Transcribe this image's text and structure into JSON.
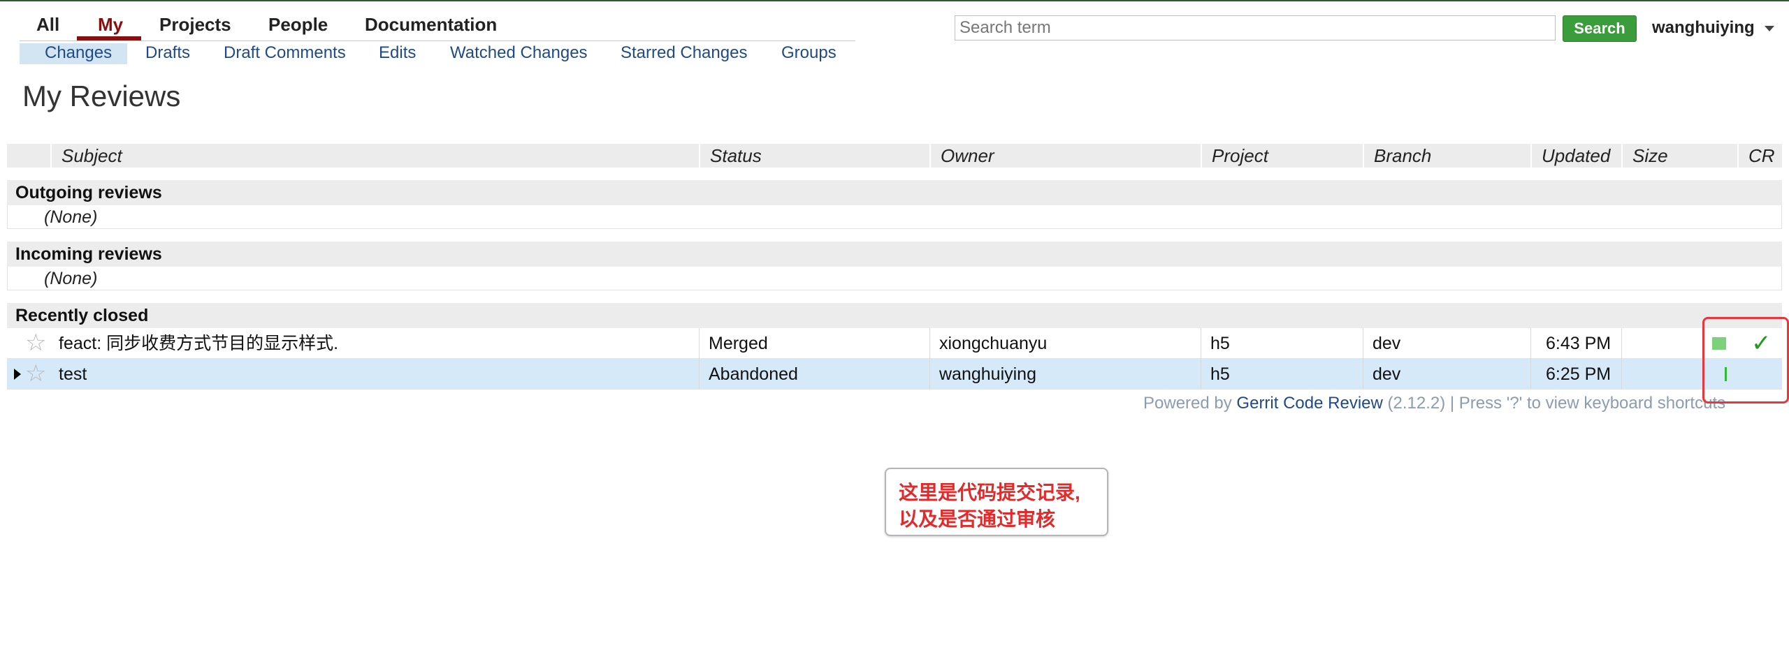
{
  "top_menu": {
    "items": [
      "All",
      "My",
      "Projects",
      "People",
      "Documentation"
    ],
    "active": "My"
  },
  "sub_menu": {
    "items": [
      "Changes",
      "Drafts",
      "Draft Comments",
      "Edits",
      "Watched Changes",
      "Starred Changes",
      "Groups"
    ],
    "selected": "Changes"
  },
  "search": {
    "placeholder": "Search term",
    "button_label": "Search"
  },
  "user": {
    "name": "wanghuiying"
  },
  "page": {
    "title": "My Reviews"
  },
  "table": {
    "columns": [
      "Subject",
      "Status",
      "Owner",
      "Project",
      "Branch",
      "Updated",
      "Size",
      "CR"
    ],
    "sections": [
      {
        "title": "Outgoing reviews",
        "empty_text": "(None)"
      },
      {
        "title": "Incoming reviews",
        "empty_text": "(None)"
      },
      {
        "title": "Recently closed"
      }
    ],
    "rows": [
      {
        "subject": "feact: 同步收费方式节目的显示样式.",
        "status": "Merged",
        "owner": "xiongchuanyu",
        "project": "h5",
        "branch": "dev",
        "updated": "6:43 PM",
        "cr": "✓"
      },
      {
        "subject": "test",
        "status": "Abandoned",
        "owner": "wanghuiying",
        "project": "h5",
        "branch": "dev",
        "updated": "6:25 PM",
        "cr": ""
      }
    ]
  },
  "footer": {
    "prefix": "Powered by",
    "link": "Gerrit Code Review",
    "suffix": "(2.12.2) | Press '?' to view keyboard shortcuts"
  },
  "annotation": {
    "line1": "这里是代码提交记录,",
    "line2": "以及是否通过审核"
  },
  "colors": {
    "accent": "#8a0e0e",
    "link": "#1f4a8a",
    "search_button": "#3a9c3a",
    "selected_row": "#d6e9f8",
    "annotation_red": "#e8363a"
  }
}
